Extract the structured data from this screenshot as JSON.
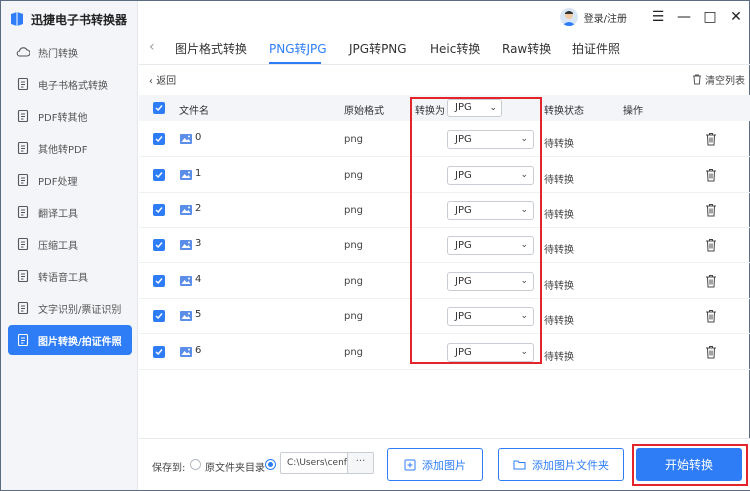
{
  "app": {
    "title": "迅捷电子书转换器",
    "login_label": "登录/注册"
  },
  "window_controls": {
    "menu": "☰",
    "minimize": "—",
    "maximize": "□",
    "close": "✕"
  },
  "sidebar": {
    "items": [
      {
        "label": "热门转换",
        "icon": "cloud-icon"
      },
      {
        "label": "电子书格式转换",
        "icon": "book-icon"
      },
      {
        "label": "PDF转其他",
        "icon": "pdf-export-icon"
      },
      {
        "label": "其他转PDF",
        "icon": "pdf-import-icon"
      },
      {
        "label": "PDF处理",
        "icon": "pdf-process-icon"
      },
      {
        "label": "翻译工具",
        "icon": "translate-icon"
      },
      {
        "label": "压缩工具",
        "icon": "compress-icon"
      },
      {
        "label": "转语音工具",
        "icon": "speech-icon"
      },
      {
        "label": "文字识别/票证识别",
        "icon": "ocr-icon"
      },
      {
        "label": "图片转换/拍证件照",
        "icon": "image-convert-icon",
        "active": true
      }
    ]
  },
  "tabs": {
    "items": [
      {
        "label": "图片格式转换"
      },
      {
        "label": "PNG转JPG",
        "active": true
      },
      {
        "label": "JPG转PNG"
      },
      {
        "label": "Heic转换"
      },
      {
        "label": "Raw转换"
      },
      {
        "label": "拍证件照"
      }
    ]
  },
  "toolbar": {
    "return_label": "返回",
    "clear_label": "清空列表"
  },
  "table": {
    "headers": {
      "filename": "文件名",
      "source_format": "原始格式",
      "convert_to": "转换为",
      "status": "转换状态",
      "action": "操作"
    },
    "global_target": "JPG",
    "rows": [
      {
        "name": "0",
        "format": "png",
        "target": "JPG",
        "status": "待转换"
      },
      {
        "name": "1",
        "format": "png",
        "target": "JPG",
        "status": "待转换"
      },
      {
        "name": "2",
        "format": "png",
        "target": "JPG",
        "status": "待转换"
      },
      {
        "name": "3",
        "format": "png",
        "target": "JPG",
        "status": "待转换"
      },
      {
        "name": "4",
        "format": "png",
        "target": "JPG",
        "status": "待转换"
      },
      {
        "name": "5",
        "format": "png",
        "target": "JPG",
        "status": "待转换"
      },
      {
        "name": "6",
        "format": "png",
        "target": "JPG",
        "status": "待转换"
      }
    ]
  },
  "bottom": {
    "save_to_label": "保存到:",
    "option_source_folder": "原文件夹目录",
    "path_value": "C:\\Users\\cenf...",
    "path_more": "···",
    "add_image_label": "添加图片",
    "add_folder_label": "添加图片文件夹",
    "start_label": "开始转换"
  },
  "colors": {
    "accent": "#2e7df6",
    "highlight": "#e3242b"
  }
}
